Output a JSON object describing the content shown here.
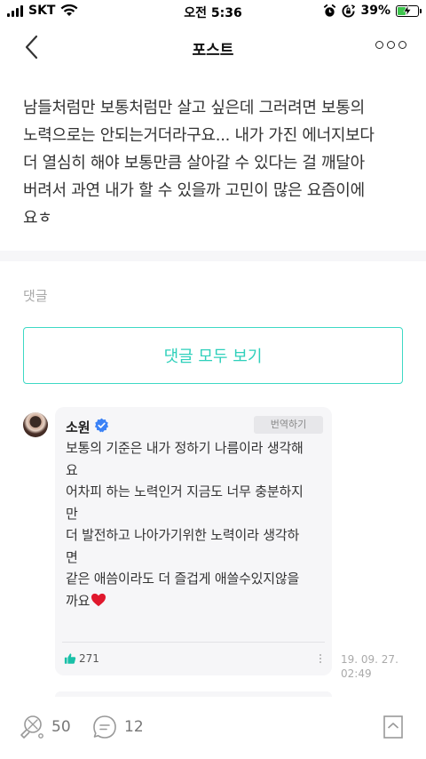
{
  "status_bar": {
    "carrier": "SKT",
    "time": "오전 5:36",
    "battery_percent": "39%",
    "battery_level": 0.39
  },
  "header": {
    "title": "포스트"
  },
  "post": {
    "lines": [
      "남들처럼만 보통처럼만 살고 싶은데 그러려면 보통의",
      "노력으로는 안되는거더라구요... 내가 가진 에너지보다",
      "더 열심히 해야 보통만큼 살아갈 수 있다는 걸 깨달아",
      "버려서 과연 내가 할 수 있을까 고민이 많은 요즘이에",
      "요ㅎ"
    ]
  },
  "comments_section": {
    "label": "댓글",
    "view_all_label": "댓글 모두 보기"
  },
  "comment": {
    "author": "소원",
    "translate_label": "번역하기",
    "lines": [
      "보통의 기준은 내가 정하기 나름이라 생각해",
      "요",
      "어차피 하는 노력인거 지금도 너무 충분하지",
      "만",
      "더 발전하고 나아가기위한 노력이라 생각하",
      "면",
      "같은 애씀이라도 더 즐겁게 애쓸수있지않을",
      "까요"
    ],
    "likes": "271",
    "date_line1": "19. 09. 27.",
    "date_line2": "02:49"
  },
  "bottom_bar": {
    "like_count": "50",
    "comment_count": "12"
  },
  "colors": {
    "accent": "#2fd0bb",
    "accent_border": "#3dd9c5",
    "heart": "#e0182d",
    "verified": "#3b82f6",
    "thumb": "#19c0a8",
    "battery": "#3dc54d"
  }
}
